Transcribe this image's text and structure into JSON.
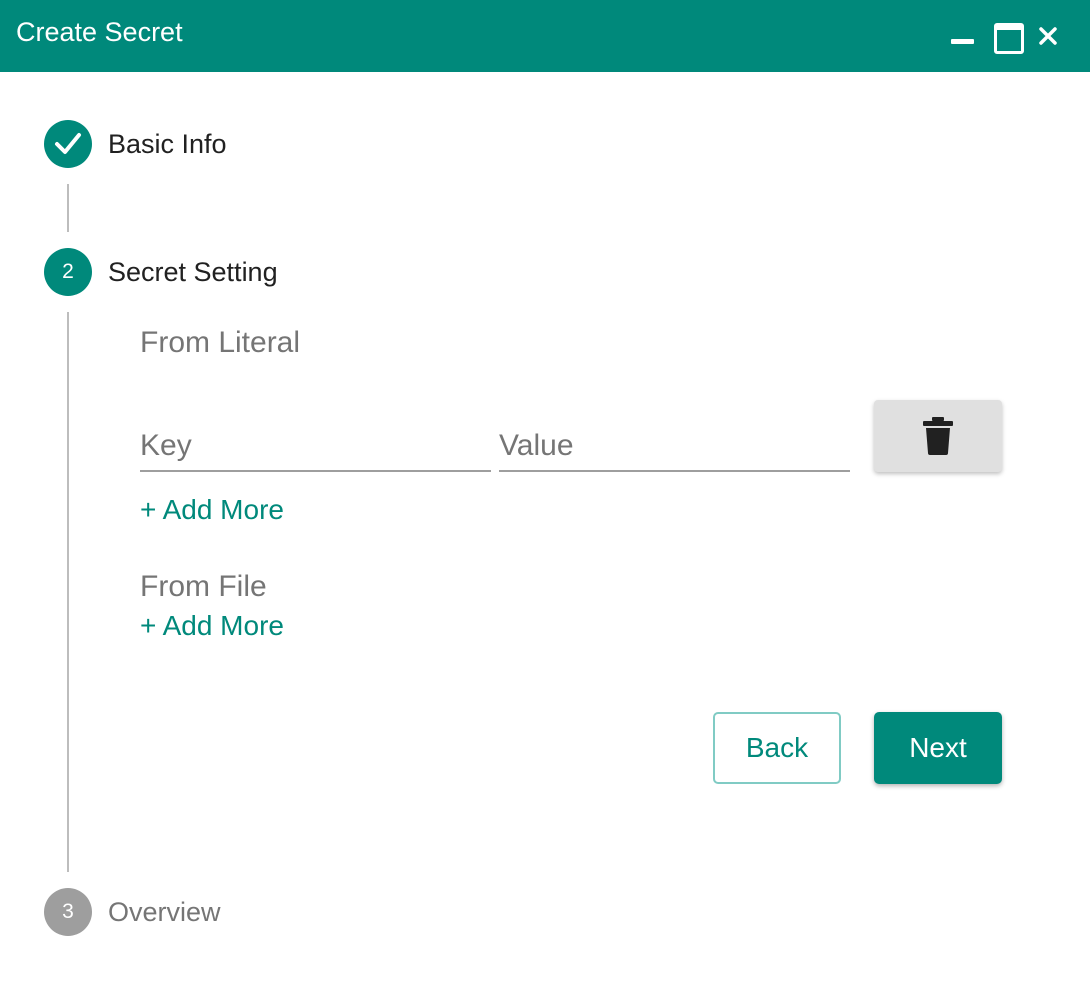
{
  "window": {
    "title": "Create Secret",
    "controls": [
      "minimize-icon",
      "maximize-icon",
      "close-icon"
    ]
  },
  "stepper": {
    "steps": [
      {
        "number": "1",
        "label": "Basic Info",
        "state": "completed",
        "icon": "check-icon"
      },
      {
        "number": "2",
        "label": "Secret Setting",
        "state": "active"
      },
      {
        "number": "3",
        "label": "Overview",
        "state": "pending"
      }
    ]
  },
  "secret_setting": {
    "from_literal": {
      "title": "From Literal",
      "key_field": {
        "placeholder": "Key",
        "value": ""
      },
      "value_field": {
        "placeholder": "Value",
        "value": ""
      },
      "delete_icon": "trash-icon",
      "add_more_label": "+ Add More"
    },
    "from_file": {
      "title": "From File",
      "add_more_label": "+ Add More"
    },
    "back_label": "Back",
    "next_label": "Next"
  },
  "colors": {
    "primary": "#00897b",
    "pending": "#9e9e9e",
    "muted_text": "#757575",
    "delete_button_bg": "#e0e0e0"
  }
}
